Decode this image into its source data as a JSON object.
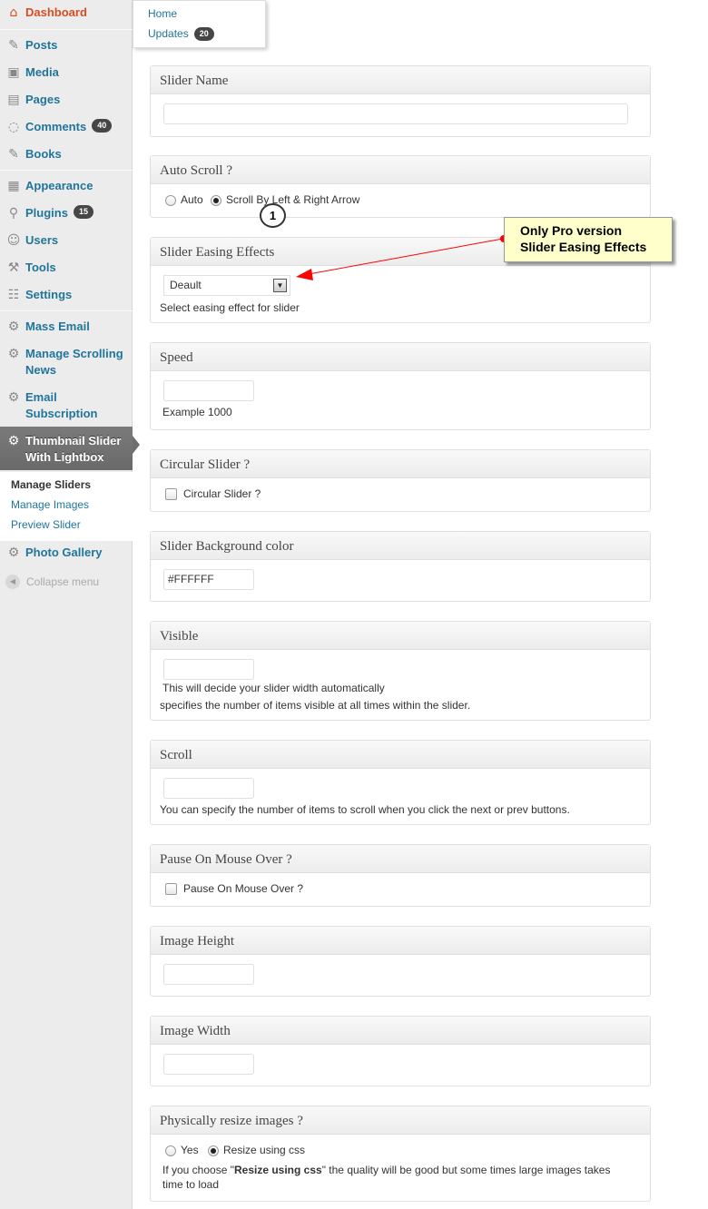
{
  "sidebar": {
    "dashboard": "Dashboard",
    "posts": "Posts",
    "media": "Media",
    "pages": "Pages",
    "comments": "Comments",
    "comments_count": "40",
    "books": "Books",
    "appearance": "Appearance",
    "plugins": "Plugins",
    "plugins_count": "15",
    "users": "Users",
    "tools": "Tools",
    "settings": "Settings",
    "mass_email": "Mass Email",
    "manage_scrolling_news": "Manage Scrolling News",
    "email_subscription": "Email Subscription",
    "thumbnail_slider": "Thumbnail Slider With Lightbox",
    "submenu": [
      "Manage Sliders",
      "Manage Images",
      "Preview Slider"
    ],
    "photo_gallery": "Photo Gallery",
    "collapse": "Collapse menu"
  },
  "flyout": {
    "home": "Home",
    "updates": "Updates",
    "updates_count": "20"
  },
  "form": {
    "slider_name": {
      "title": "Slider Name",
      "value": ""
    },
    "auto_scroll": {
      "title": "Auto Scroll ?",
      "options": [
        "Auto",
        "Scroll By Left & Right Arrow"
      ],
      "selected": "Scroll By Left & Right Arrow"
    },
    "easing": {
      "title": "Slider Easing Effects",
      "value": "Deault",
      "help": "Select easing effect for slider"
    },
    "speed": {
      "title": "Speed",
      "value": "",
      "help": "Example 1000"
    },
    "circular": {
      "title": "Circular Slider ?",
      "label": "Circular Slider ?",
      "checked": false
    },
    "bg_color": {
      "title": "Slider Background color",
      "value": "#FFFFFF"
    },
    "visible": {
      "title": "Visible",
      "value": "",
      "help1": "This will decide your slider width automatically",
      "help2": "specifies the number of items visible at all times within the slider."
    },
    "scroll": {
      "title": "Scroll",
      "value": "",
      "help": "You can specify the number of items to scroll when you click the next or prev buttons."
    },
    "pause": {
      "title": "Pause On Mouse Over ?",
      "label": "Pause On Mouse Over ?",
      "checked": false
    },
    "image_height": {
      "title": "Image Height",
      "value": ""
    },
    "image_width": {
      "title": "Image Width",
      "value": ""
    },
    "resize": {
      "title": "Physically resize images ?",
      "options": [
        "Yes",
        "Resize using css"
      ],
      "selected": "Resize using css",
      "help_pre": "If you choose \"",
      "help_bold": "Resize using css",
      "help_post": "\" the quality will be good but some times large images takes",
      "help2": "time to load"
    }
  },
  "annotation": {
    "number": "1",
    "callout_line1": "Only Pro version",
    "callout_line2": "Slider Easing Effects"
  },
  "colors": {
    "link": "#21759b",
    "dashboard": "#d54e21",
    "callout_bg": "#ffffcc",
    "arrow": "#ff0000"
  }
}
